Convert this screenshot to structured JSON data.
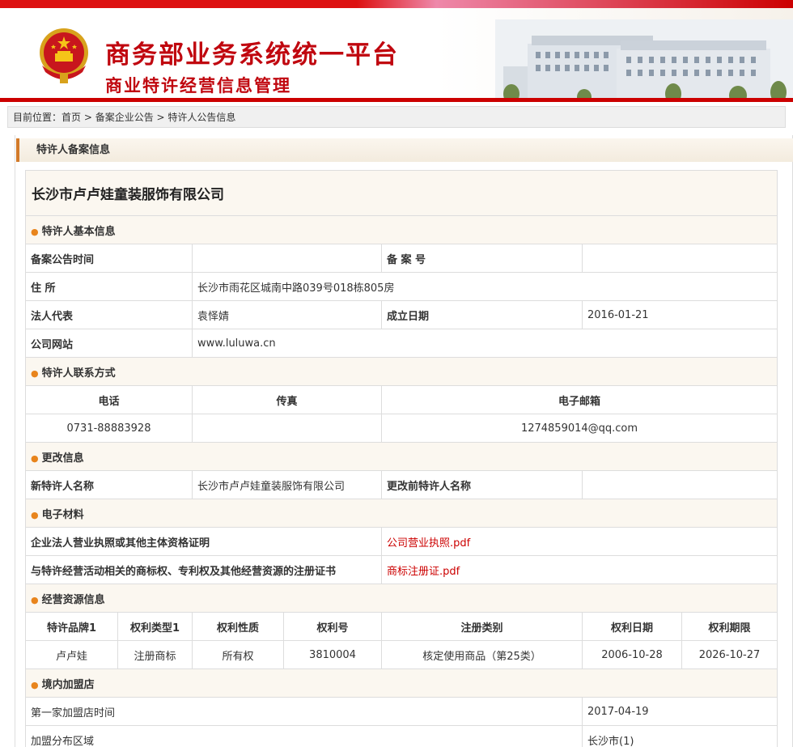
{
  "banner": {
    "title": "商务部业务系统统一平台",
    "subtitle": "商业特许经营信息管理"
  },
  "breadcrumb": {
    "prefix": "目前位置：",
    "items": [
      "首页",
      "备案企业公告",
      "特许人公告信息"
    ],
    "separator": " > "
  },
  "section_title": "特许人备案信息",
  "company": {
    "name": "长沙市卢卢娃童装服饰有限公司"
  },
  "basic_info": {
    "heading": "特许人基本信息",
    "filing_date_label": "备案公告时间",
    "filing_date": "",
    "filing_no_label": "备 案 号",
    "filing_no": "",
    "address_label": "住 所",
    "address": "长沙市雨花区城南中路039号018栋805房",
    "legal_rep_label": "法人代表",
    "legal_rep": "袁怿婧",
    "founded_label": "成立日期",
    "founded": "2016-01-21",
    "website_label": "公司网站",
    "website": "www.luluwa.cn"
  },
  "contact": {
    "heading": "特许人联系方式",
    "phone_label": "电话",
    "fax_label": "传真",
    "email_label": "电子邮箱",
    "phone": "0731-88883928",
    "fax": "",
    "email": "1274859014@qq.com"
  },
  "change_info": {
    "heading": "更改信息",
    "new_name_label": "新特许人名称",
    "new_name": "长沙市卢卢娃童装服饰有限公司",
    "old_name_label": "更改前特许人名称",
    "old_name": ""
  },
  "materials": {
    "heading": "电子材料",
    "items": [
      {
        "label": "企业法人营业执照或其他主体资格证明",
        "file": "公司营业执照.pdf"
      },
      {
        "label": "与特许经营活动相关的商标权、专利权及其他经营资源的注册证书",
        "file": "商标注册证.pdf"
      }
    ]
  },
  "resources": {
    "heading": "经营资源信息",
    "columns": [
      "特许品牌1",
      "权利类型1",
      "权利性质",
      "权利号",
      "注册类别",
      "权利日期",
      "权利期限"
    ],
    "rows": [
      [
        "卢卢娃",
        "注册商标",
        "所有权",
        "3810004",
        "核定使用商品（第25类）",
        "2006-10-28",
        "2026-10-27"
      ]
    ]
  },
  "domestic_stores": {
    "heading": "境内加盟店",
    "first_store_label": "第一家加盟店时间",
    "first_store": "2017-04-19",
    "region_label": "加盟分布区域",
    "region": "长沙市(1)"
  },
  "colors": {
    "brand_red": "#c0070f",
    "accent_orange": "#e8841c",
    "link_red": "#cc0000"
  }
}
